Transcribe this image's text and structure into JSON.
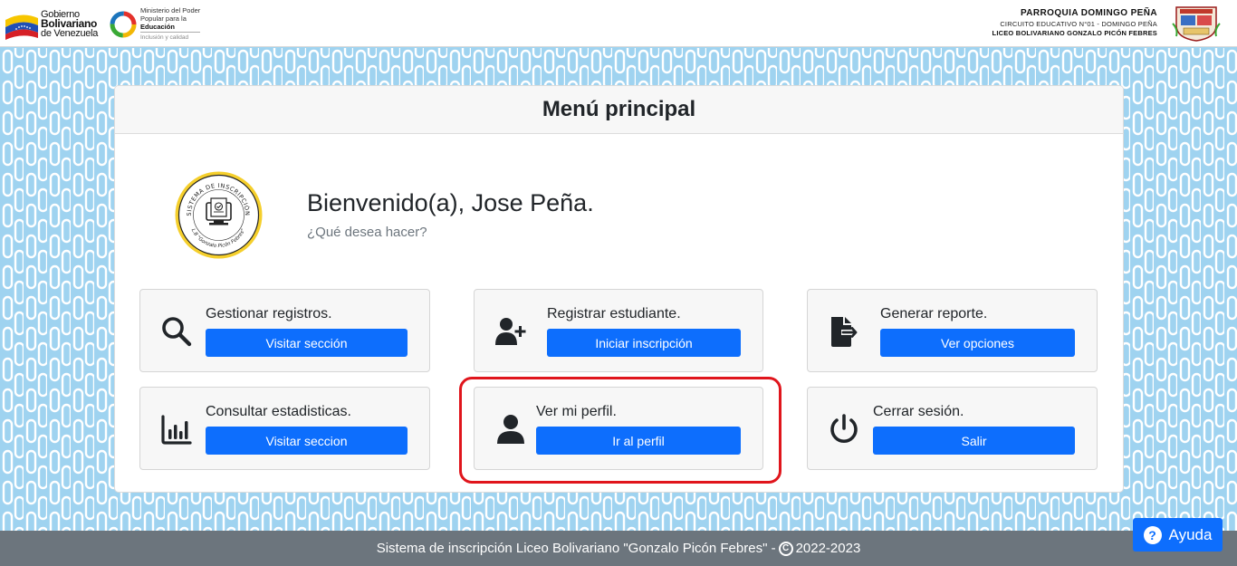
{
  "header": {
    "gobierno": {
      "line1": "Gobierno",
      "line2": "Bolivariano",
      "line3": "de Venezuela"
    },
    "ministerio": {
      "line1": "Ministerio del Poder",
      "line2": "Popular para la",
      "line3": "Educación",
      "line4": "Inclusión y calidad"
    },
    "school": {
      "parroquia": "PARROQUIA DOMINGO PEÑA",
      "circuito": "CIRCUITO EDUCATIVO N°01 - DOMINGO PEÑA",
      "liceo": "LICEO BOLIVARIANO GONZALO PICÓN FEBRES"
    }
  },
  "card": {
    "title": "Menú principal",
    "seal": {
      "top_text": "SISTEMA DE INSCRIPCIÓN",
      "bottom_text": "L.B \"Gonzalo Picón Febres\""
    },
    "welcome": "Bienvenido(a), Jose Peña.",
    "subtitle": "¿Qué desea hacer?"
  },
  "tiles": [
    {
      "label": "Gestionar registros.",
      "button": "Visitar sección",
      "icon": "search-icon"
    },
    {
      "label": "Registrar estudiante.",
      "button": "Iniciar inscripción",
      "icon": "user-plus-icon"
    },
    {
      "label": "Generar reporte.",
      "button": "Ver opciones",
      "icon": "file-export-icon"
    },
    {
      "label": "Consultar estadisticas.",
      "button": "Visitar seccion",
      "icon": "chart-bar-icon"
    },
    {
      "label": "Ver mi perfil.",
      "button": "Ir al perfil",
      "icon": "user-icon"
    },
    {
      "label": "Cerrar sesión.",
      "button": "Salir",
      "icon": "power-icon"
    }
  ],
  "footer": {
    "text": "Sistema de inscripción Liceo Bolivariano \"Gonzalo Picón Febres\" -",
    "copyright_symbol": "C",
    "years": "2022-2023"
  },
  "help": {
    "label": "Ayuda",
    "icon": "question-circle-icon"
  },
  "colors": {
    "primary": "#0d6efd",
    "footer": "#6c757d",
    "highlight": "#e0151c",
    "pattern_bg": "#9fd3f0"
  }
}
